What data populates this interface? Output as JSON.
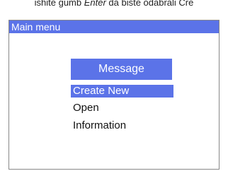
{
  "caption": {
    "prefix": "ishite gumb ",
    "key": "Enter",
    "suffix": " da biste odabrali Cre"
  },
  "screen": {
    "title": "Main menu",
    "heading": "Message",
    "menu_items": [
      {
        "label": "Create New",
        "selected": true
      },
      {
        "label": "Open",
        "selected": false
      },
      {
        "label": "Information",
        "selected": false
      }
    ]
  },
  "colors": {
    "accent": "#5b73e8",
    "text": "#111111",
    "highlight_text": "#ffffff"
  }
}
